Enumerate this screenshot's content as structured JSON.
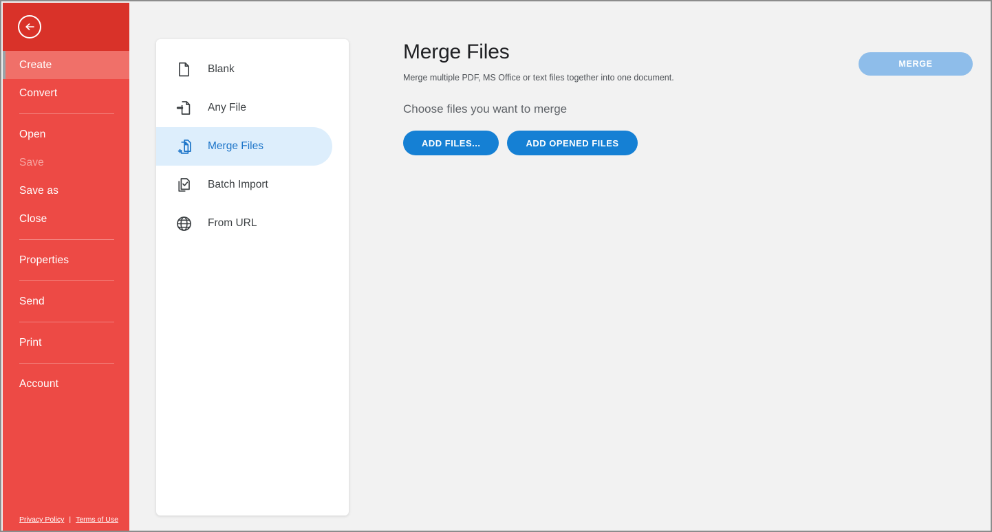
{
  "theme": {
    "sidebar_bg": "#ed4a45",
    "sidebar_header_bg": "#d93229",
    "sidebar_active_bg": "#f07069",
    "accent_blue": "#1580d4",
    "selected_row_bg": "#ddeefc",
    "selected_row_text": "#1a73c8",
    "disabled_blue": "#8ebdea",
    "page_bg": "#f2f2f2"
  },
  "sidebar": {
    "back_icon": "arrow-left-circle-icon",
    "items": [
      {
        "label": "Create",
        "state": "active"
      },
      {
        "label": "Convert",
        "state": "normal"
      },
      {
        "label": "Open",
        "state": "normal"
      },
      {
        "label": "Save",
        "state": "disabled"
      },
      {
        "label": "Save as",
        "state": "normal"
      },
      {
        "label": "Close",
        "state": "normal"
      },
      {
        "label": "Properties",
        "state": "normal"
      },
      {
        "label": "Send",
        "state": "normal"
      },
      {
        "label": "Print",
        "state": "normal"
      },
      {
        "label": "Account",
        "state": "normal"
      }
    ],
    "footer": {
      "privacy_label": "Privacy Policy",
      "divider": "|",
      "terms_label": "Terms of Use"
    }
  },
  "list_panel": {
    "items": [
      {
        "label": "Blank",
        "icon": "document-blank-icon",
        "selected": false
      },
      {
        "label": "Any File",
        "icon": "file-import-icon",
        "selected": false
      },
      {
        "label": "Merge Files",
        "icon": "documents-merge-plus-icon",
        "selected": true
      },
      {
        "label": "Batch Import",
        "icon": "documents-check-icon",
        "selected": false
      },
      {
        "label": "From URL",
        "icon": "globe-icon",
        "selected": false
      }
    ]
  },
  "main": {
    "title": "Merge Files",
    "subtitle": "Merge multiple PDF, MS Office or text files together into one document.",
    "prompt": "Choose files you want to merge",
    "add_files_label": "ADD FILES...",
    "add_opened_files_label": "ADD OPENED FILES",
    "merge_label": "MERGE"
  }
}
